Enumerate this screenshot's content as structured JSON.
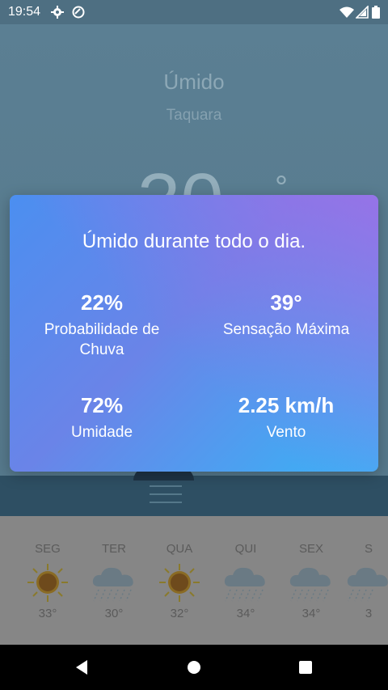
{
  "status_bar": {
    "time": "19:54"
  },
  "background": {
    "condition": "Úmido",
    "city": "Taquara",
    "temp_partial": "30",
    "degree": "°"
  },
  "dialog": {
    "title": "Úmido durante todo o dia.",
    "stats": [
      {
        "value": "22%",
        "label": "Probabilidade de Chuva"
      },
      {
        "value": "39°",
        "label": "Sensação Máxima"
      },
      {
        "value": "72%",
        "label": "Umidade"
      },
      {
        "value": "2.25 km/h",
        "label": "Vento"
      }
    ]
  },
  "forecast": [
    {
      "day": "SEG",
      "temp": "33°",
      "icon": "sun-icon"
    },
    {
      "day": "TER",
      "temp": "30°",
      "icon": "rain-icon"
    },
    {
      "day": "QUA",
      "temp": "32°",
      "icon": "sun-icon"
    },
    {
      "day": "QUI",
      "temp": "34°",
      "icon": "rain-icon"
    },
    {
      "day": "SEX",
      "temp": "34°",
      "icon": "rain-icon"
    },
    {
      "day": "S",
      "temp": "3",
      "icon": "rain-icon"
    }
  ]
}
